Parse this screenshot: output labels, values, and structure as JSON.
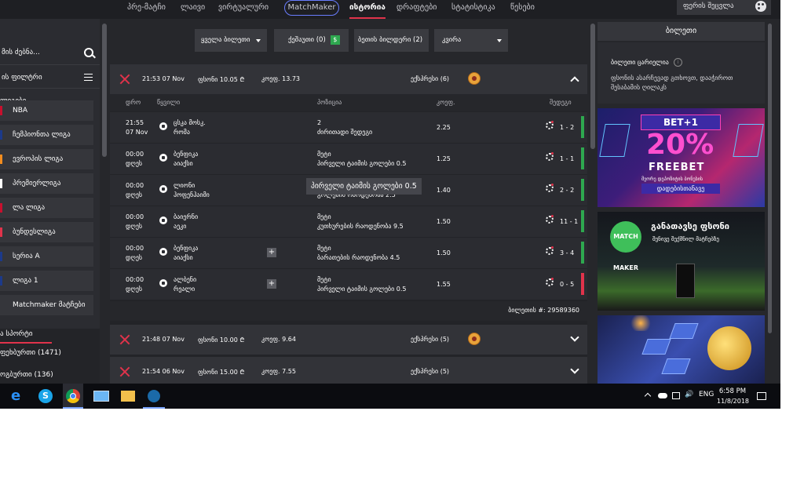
{
  "nav": {
    "items": [
      "პრე-მატჩი",
      "ლაივი",
      "ვირტუალური",
      "MatchMaker",
      "ისტორია",
      "დრაფტები",
      "სტატისტიკა",
      "წესები"
    ],
    "search_label": "ფერის შეცვლა"
  },
  "sidebar": {
    "search_label": "მის ძებნა...",
    "filter_label": "ის ფილტრი",
    "section_label": "ლიგები",
    "leagues": [
      {
        "label": "NBA",
        "flag_color": "#c8102e"
      },
      {
        "label": "ჩემპიონთა ლიგა",
        "flag_color": "#1c3a8a"
      },
      {
        "label": "ევროპის ლიგა",
        "flag_color": "#f28c1f"
      },
      {
        "label": "პრემიერლიგა",
        "flag_color": "#ffffff"
      },
      {
        "label": "ლა ლიგა",
        "flag_color": "#c8102e"
      },
      {
        "label": "ბუნდესლიგა",
        "flag_color": "#e0334b"
      },
      {
        "label": "სერია A",
        "flag_color": "#1c3a8a"
      },
      {
        "label": "ლიგა 1",
        "flag_color": "#1c3a8a"
      },
      {
        "label": "Matchmaker მატჩები",
        "flag_color": "#35363b"
      }
    ],
    "sports_label": "ა სპორტი",
    "sports": [
      "ფეხბურთი (1471)",
      "ოგბურთი (136)"
    ]
  },
  "filters": {
    "all_tickets": "ყველა ბილეთი",
    "cashout": "ქეშაუთი (0)",
    "cashout_icon": "$",
    "bet_builder": "ბეთის ბილდერი (2)",
    "date": "კვირა"
  },
  "bets": [
    {
      "time": "21:53 07 Nov",
      "stake": "ფსონი  10.05 ₾",
      "coef": "კოეფ.  13.73",
      "type": "ექსპრესი (6)",
      "expanded": true
    },
    {
      "time": "21:48 07 Nov",
      "stake": "ფსონი  10.00 ₾",
      "coef": "კოეფ.  9.64",
      "type": "ექსპრესი (5)",
      "expanded": false
    },
    {
      "time": "21:54 06 Nov",
      "stake": "ფსონი  15.00 ₾",
      "coef": "კოეფ.  7.55",
      "type": "ექსპრესი (5)",
      "expanded": false
    }
  ],
  "columns": {
    "time": "დრო",
    "pair": "წყვილი",
    "position": "პოზიცია",
    "coef": "კოეფ.",
    "result": "შედეგი"
  },
  "rows": [
    {
      "date1": "21:55",
      "date2": "07 Nov",
      "team1": "ცსკა მოსკ.",
      "team2": "რომა",
      "pos1": "2",
      "pos2": "ძირითადი შედეგი",
      "coef": "2.25",
      "score": "1 - 2",
      "status_color": "#2ea84f",
      "plus": false
    },
    {
      "date1": "00:00",
      "date2": "დღეს",
      "team1": "ბენფიკა",
      "team2": "აიაქსი",
      "pos1": "მეტი",
      "pos2": "პირველი ტაიმის გოლები 0.5",
      "coef": "1.25",
      "score": "1 - 1",
      "status_color": "#2ea84f",
      "plus": false
    },
    {
      "date1": "00:00",
      "date2": "დღეს",
      "team1": "ლიონი",
      "team2": "ჰოფენჰაიმი",
      "pos1": "მეტი",
      "pos2": "გოლების რაოდენობა 2.5",
      "coef": "1.40",
      "score": "2 - 2",
      "status_color": "#2ea84f",
      "plus": false
    },
    {
      "date1": "00:00",
      "date2": "დღეს",
      "team1": "ბაიერნი",
      "team2": "აეკი",
      "pos1": "მეტი",
      "pos2": "კუთხურების რაოდენობა 9.5",
      "coef": "1.50",
      "score": "11 - 1",
      "status_color": "#2ea84f",
      "plus": false
    },
    {
      "date1": "00:00",
      "date2": "დღეს",
      "team1": "ბენფიკა",
      "team2": "აიაქსი",
      "pos1": "მეტი",
      "pos2": "ბარათების რაოდენობა 4.5",
      "coef": "1.50",
      "score": "3 - 4",
      "status_color": "#2ea84f",
      "plus": true
    },
    {
      "date1": "00:00",
      "date2": "დღეს",
      "team1": "ალბენი",
      "team2": "რეალი",
      "pos1": "მეტი",
      "pos2": "პირველი ტაიმის გოლები 0.5",
      "coef": "1.55",
      "score": "0 - 5",
      "status_color": "#e0334b",
      "plus": true
    }
  ],
  "tooltip": "პირველი ტაიმის გოლები 0.5",
  "ticket_id": "ბილეთის #:  29589360",
  "ticket_panel": {
    "title": "ბილეთი",
    "empty": "ბილეთი ცარიელია",
    "description": "ფსონის ასარჩევად გთხოვთ, დააჭიროთ შესაბამის ღილაკს"
  },
  "banners": {
    "b1_header": "BET+1",
    "b1_pct": "20%",
    "b1_free": "FREEBET",
    "b1_small": "მეორე დეპოზიტის ბონუსის",
    "b1_cta": "დადებისთანავე",
    "b2_logo": "MATCH MAKER",
    "b2_title": "განათავსე ფსონი",
    "b2_sub": "შენივე შექმნილ მატჩებზე"
  },
  "taskbar": {
    "lang": "ENG",
    "time": "6:58 PM",
    "date": "11/8/2018"
  }
}
